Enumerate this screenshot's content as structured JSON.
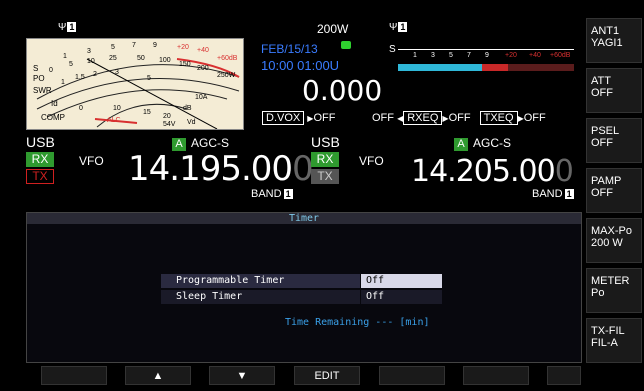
{
  "top": {
    "ant_left_num": "1",
    "ant_right_num": "1",
    "power": "200W",
    "date": "FEB/15/13",
    "time": "10:00 01:00U",
    "rit_value": "0.000",
    "dvox_label": "D.VOX",
    "dvox_state": "OFF",
    "off_left": "OFF",
    "rxeq_label": "RXEQ",
    "rxeq_state": "OFF",
    "txeq_label": "TXEQ",
    "txeq_state": "OFF",
    "s_label": "S"
  },
  "meter": {
    "labels": [
      "S",
      "PO",
      "SWR",
      "Id",
      "COMP"
    ],
    "alc": "ALC",
    "numbers": [
      "1",
      "3",
      "5",
      "7",
      "9",
      "+20",
      "+40",
      "+60dB",
      "0",
      "5",
      "10",
      "25",
      "50",
      "100",
      "150",
      "200",
      "250W",
      "1",
      "1.5",
      "2",
      "3",
      "5",
      "10A",
      "dB",
      "0",
      "10",
      "15",
      "20",
      "54V",
      "Vd"
    ]
  },
  "smeter": {
    "scale": [
      "1",
      "3",
      "5",
      "7",
      "9",
      "+20",
      "+40",
      "+60dB"
    ]
  },
  "main": {
    "mode": "USB",
    "rx": "RX",
    "tx": "TX",
    "vfo": "VFO",
    "agc_badge": "A",
    "agc": "AGC-S",
    "freq_main": "14.195.00",
    "freq_dim": "0",
    "band": "BAND",
    "band_num": "1"
  },
  "sub": {
    "mode": "USB",
    "rx": "RX",
    "tx": "TX",
    "vfo": "VFO",
    "agc_badge": "A",
    "agc": "AGC-S",
    "freq_main": "14.205.00",
    "freq_dim": "0",
    "band": "BAND",
    "band_num": "1"
  },
  "side_keys": [
    {
      "l1": "ANT1",
      "l2": "YAGI1"
    },
    {
      "l1": "ATT",
      "l2": "OFF"
    },
    {
      "l1": "PSEL",
      "l2": "OFF"
    },
    {
      "l1": "PAMP",
      "l2": "OFF"
    },
    {
      "l1": "MAX-Po",
      "l2": "200 W"
    },
    {
      "l1": "METER",
      "l2": "Po"
    },
    {
      "l1": "TX-FIL",
      "l2": "FIL-A"
    }
  ],
  "dialog": {
    "title": "Timer",
    "rows": [
      {
        "label": "Programmable Timer",
        "value": "Off"
      },
      {
        "label": "Sleep Timer",
        "value": "Off"
      }
    ],
    "remaining": "Time Remaining  --- [min]"
  },
  "fkeys": {
    "f3": "EDIT"
  },
  "colors": {
    "rx_green": "#2f9a2f",
    "tx_red": "#d02020",
    "cyan_text": "#3aa0e8",
    "blue_text": "#3a7cff"
  }
}
